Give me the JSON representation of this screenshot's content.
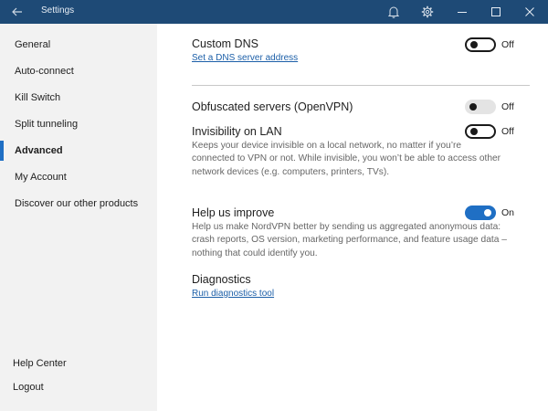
{
  "window": {
    "title": "Settings",
    "icons": [
      "back-arrow-icon",
      "bell-icon",
      "gear-icon",
      "minimize-icon",
      "maximize-icon",
      "close-icon"
    ]
  },
  "sidebar": {
    "items": [
      {
        "label": "General"
      },
      {
        "label": "Auto-connect"
      },
      {
        "label": "Kill Switch"
      },
      {
        "label": "Split tunneling"
      },
      {
        "label": "Advanced",
        "active": true
      },
      {
        "label": "My Account"
      },
      {
        "label": "Discover our other products"
      }
    ],
    "help_center": "Help Center",
    "logout": "Logout"
  },
  "main": {
    "custom_dns": {
      "title": "Custom DNS",
      "link": "Set a DNS server address",
      "state": "Off"
    },
    "obfuscated": {
      "title": "Obfuscated servers (OpenVPN)",
      "state": "Off"
    },
    "invisibility": {
      "title": "Invisibility on LAN",
      "state": "Off",
      "description_lines": [
        "Keeps your device invisible on a local network, no matter if you’re",
        "connected to VPN or not. While invisible, you won’t be able to access other",
        "network devices (e.g. computers, printers, TVs)."
      ]
    },
    "help_improve": {
      "title": "Help us improve",
      "state": "On",
      "description_lines": [
        "Help us make NordVPN better by sending us aggregated anonymous data:",
        "crash reports, OS version, marketing performance, and feature usage data –",
        "nothing that could identify you."
      ]
    },
    "diagnostics": {
      "title": "Diagnostics",
      "link": "Run diagnostics tool"
    }
  },
  "colors": {
    "titlebar": "#1e4a76",
    "accent": "#1f6fc4",
    "sidebar_bg": "#f2f2f2",
    "link": "#1c5fa8"
  }
}
